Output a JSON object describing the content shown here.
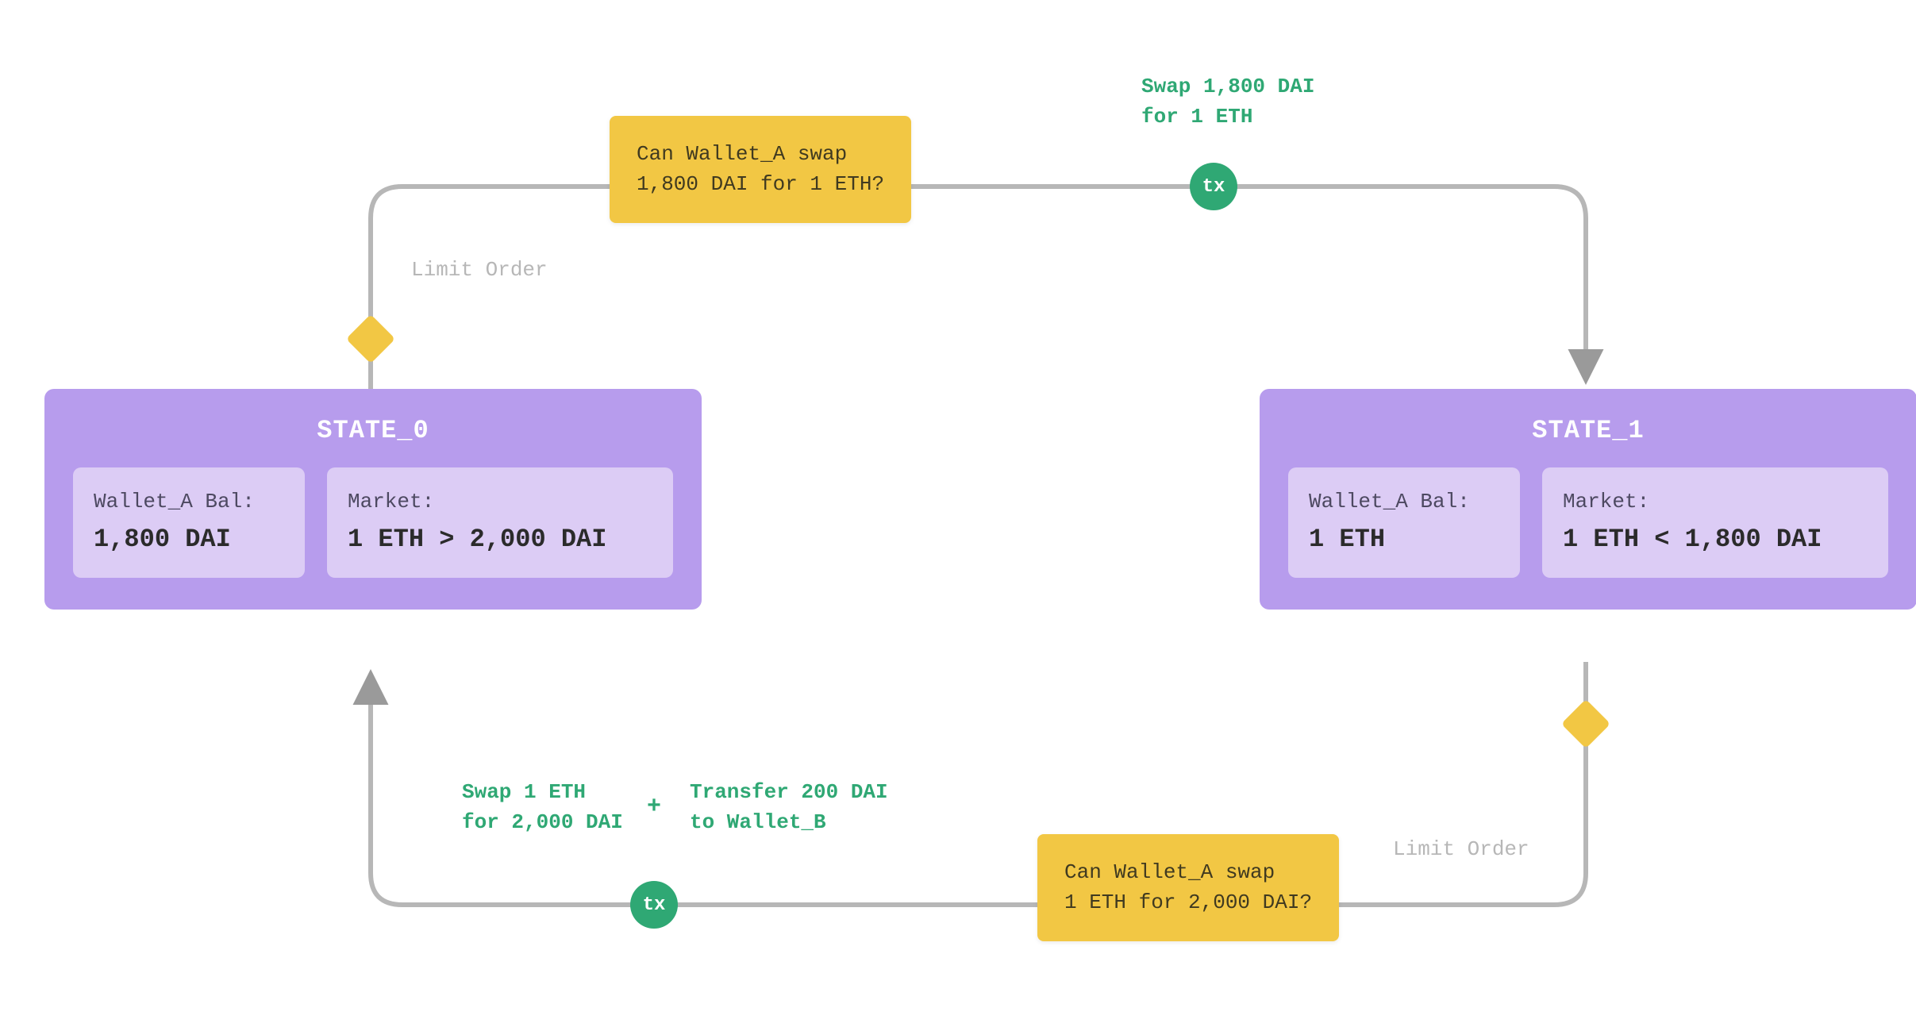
{
  "states": {
    "s0": {
      "title": "STATE_0",
      "wallet_label": "Wallet_A Bal:",
      "wallet_value": "1,800 DAI",
      "market_label": "Market:",
      "market_value": "1 ETH > 2,000 DAI"
    },
    "s1": {
      "title": "STATE_1",
      "wallet_label": "Wallet_A Bal:",
      "wallet_value": "1 ETH",
      "market_label": "Market:",
      "market_value": "1 ETH < 1,800 DAI"
    }
  },
  "decisions": {
    "top": "Can Wallet_A swap\n1,800 DAI for 1 ETH?",
    "bottom": "Can Wallet_A swap\n1 ETH for 2,000 DAI?"
  },
  "tx_label": "tx",
  "tx_actions": {
    "top": "Swap 1,800 DAI\nfor 1 ETH",
    "bottom_left": "Swap 1 ETH\nfor 2,000 DAI",
    "bottom_right": "Transfer 200 DAI\nto Wallet_B",
    "plus": "+"
  },
  "edge_labels": {
    "top_left": "Limit Order",
    "bottom_right": "Limit Order"
  }
}
